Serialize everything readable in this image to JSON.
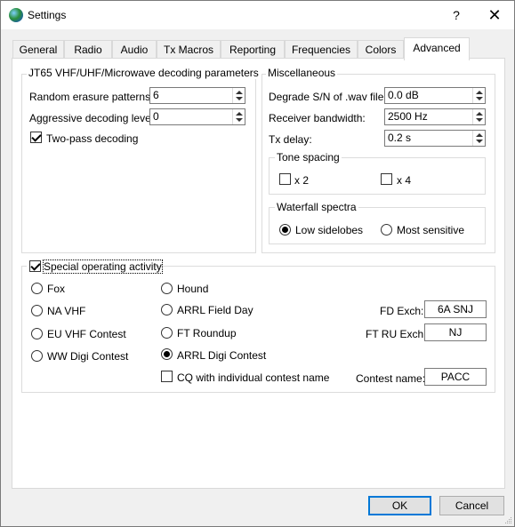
{
  "window": {
    "title": "Settings",
    "help_label": "?",
    "close_label": "✕"
  },
  "tabs": [
    {
      "label": "General"
    },
    {
      "label": "Radio"
    },
    {
      "label": "Audio"
    },
    {
      "label": "Tx Macros"
    },
    {
      "label": "Reporting"
    },
    {
      "label": "Frequencies"
    },
    {
      "label": "Colors"
    },
    {
      "label": "Advanced",
      "active": true
    }
  ],
  "jt65_group": {
    "title": "JT65 VHF/UHF/Microwave decoding parameters",
    "random_erasure_label": "Random erasure patterns:",
    "random_erasure_value": "6",
    "aggressive_label": "Aggressive decoding level:",
    "aggressive_value": "0",
    "two_pass_label": "Two-pass decoding",
    "two_pass_checked": true
  },
  "misc_group": {
    "title": "Miscellaneous",
    "degrade_label": "Degrade S/N of .wav file:",
    "degrade_value": "0.0 dB",
    "bandwidth_label": "Receiver bandwidth:",
    "bandwidth_value": "2500  Hz",
    "txdelay_label": "Tx delay:",
    "txdelay_value": "0.2  s",
    "tone_spacing_title": "Tone spacing",
    "x2_label": "x 2",
    "x4_label": "x 4",
    "waterfall_title": "Waterfall spectra",
    "low_sidelobes_label": "Low sidelobes",
    "most_sensitive_label": "Most sensitive",
    "waterfall_selected": "Low sidelobes"
  },
  "special_group": {
    "title": "Special operating activity",
    "checked": true,
    "options": {
      "fox": "Fox",
      "hound": "Hound",
      "na_vhf": "NA VHF",
      "arrl_field_day": "ARRL Field Day",
      "eu_vhf": "EU VHF Contest",
      "ft_roundup": "FT Roundup",
      "ww_digi": "WW Digi Contest",
      "arrl_digi": "ARRL Digi Contest"
    },
    "selected": "ARRL Digi Contest",
    "cq_label": "CQ with individual contest name",
    "fd_exch_label": "FD Exch:",
    "fd_exch_value": "6A SNJ",
    "ft_ru_exch_label": "FT RU Exch:",
    "ft_ru_exch_value": "NJ",
    "contest_name_label": "Contest name:",
    "contest_name_value": "PACC"
  },
  "buttons": {
    "ok": "OK",
    "cancel": "Cancel"
  }
}
